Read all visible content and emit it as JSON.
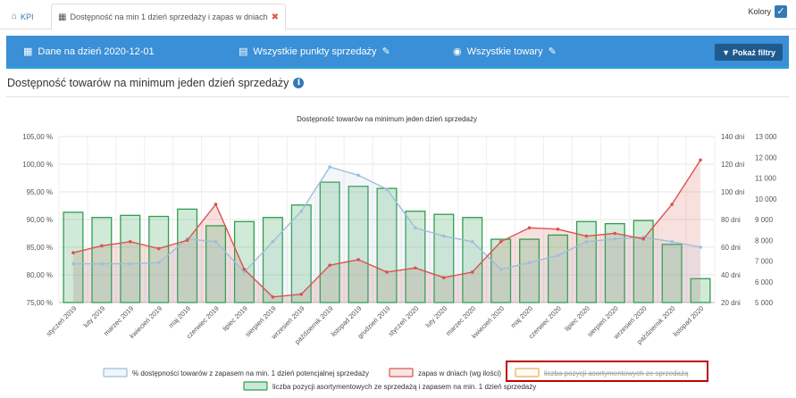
{
  "tabs": {
    "kpi_label": "KPI",
    "active_label": "Dostępność na min 1 dzień sprzedaży i zapas w dniach"
  },
  "colors_toggle": {
    "label": "Kolory",
    "checked": true
  },
  "filter_bar": {
    "date_label": "Dane na dzień 2020-12-01",
    "points_label": "Wszystkie punkty sprzedaży",
    "goods_label": "Wszystkie towary",
    "show_filters_label": "Pokaż filtry"
  },
  "panel": {
    "title": "Dostępność towarów na minimum jeden dzień sprzedaży"
  },
  "accent_colors": {
    "bar": "#3a8fd6",
    "line_pct": "#9dbfd8",
    "line_zapas": "#d9534f",
    "bars_green": "#2e9e4f",
    "highlight_box": "#c00000"
  },
  "chart_data": {
    "type": "bar",
    "title": "Dostępność towarów na minimum jeden dzień sprzedaży",
    "categories": [
      "styczeń 2019",
      "luty 2019",
      "marzec 2019",
      "kwiecień 2019",
      "maj 2019",
      "czerwiec 2019",
      "lipiec 2019",
      "sierpień 2019",
      "wrzesień 2019",
      "październik 2019",
      "listopad 2019",
      "grudzień 2019",
      "styczeń 2020",
      "luty 2020",
      "marzec 2020",
      "kwiecień 2020",
      "maj 2020",
      "czerwiec 2020",
      "lipiec 2020",
      "sierpień 2020",
      "wrzesień 2020",
      "październik 2020",
      "listopad 2020"
    ],
    "axes": {
      "left": {
        "min": 75,
        "max": 105,
        "ticks": [
          "75,00 %",
          "80,00 %",
          "85,00 %",
          "90,00 %",
          "95,00 %",
          "100,00 %",
          "105,00 %"
        ]
      },
      "right1": {
        "min": 20,
        "max": 140,
        "ticks": [
          "20 dni",
          "40 dni",
          "60 dni",
          "80 dni",
          "100 dni",
          "120 dni",
          "140 dni"
        ]
      },
      "right2": {
        "min": 5000,
        "max": 13000,
        "ticks": [
          "5 000",
          "6 000",
          "7 000",
          "8 000",
          "9 000",
          "10 000",
          "11 000",
          "12 000",
          "13 000"
        ]
      }
    },
    "series": [
      {
        "name": "% dostępności towarów z zapasem na min. 1 dzień potencjalnej sprzedaży",
        "type": "line",
        "axis": "left",
        "color": "#9dbfd8",
        "values": [
          82.0,
          82.0,
          82.0,
          82.2,
          86.5,
          86.0,
          80.5,
          86.0,
          91.5,
          99.5,
          98.0,
          95.5,
          88.5,
          87.0,
          86.0,
          81.0,
          82.2,
          83.5,
          86.0,
          86.5,
          86.8,
          86.0,
          85.0
        ]
      },
      {
        "name": "zapas w dniach (wg ilości)",
        "type": "area",
        "axis": "right1",
        "color": "#d9534f",
        "values": [
          56,
          61,
          64,
          59,
          65,
          91,
          44,
          24,
          26,
          47,
          51,
          42,
          45,
          38,
          42,
          64,
          74,
          73,
          68,
          70,
          66,
          91,
          123
        ]
      },
      {
        "name": "liczba pozycji asortymentowych ze sprzedażą",
        "type": "bar",
        "axis": "right2",
        "color": "#f0ad4e",
        "hidden": true,
        "values": []
      },
      {
        "name": "liczba pozycji asortymentowych ze sprzedażą i zapasem na min. 1 dzień sprzedaży",
        "type": "bar",
        "axis": "right2",
        "color": "#2e9e4f",
        "values": [
          9350,
          9100,
          9200,
          9150,
          9500,
          8700,
          8900,
          9100,
          9700,
          10800,
          10600,
          10500,
          9400,
          9250,
          9100,
          8050,
          8050,
          8250,
          8900,
          8800,
          8950,
          7800,
          6150
        ]
      }
    ],
    "legend": "bottom"
  }
}
